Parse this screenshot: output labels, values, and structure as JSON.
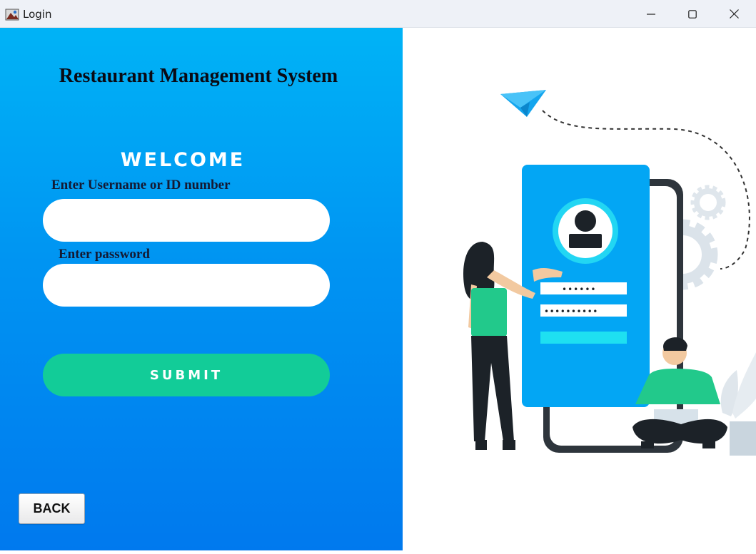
{
  "window": {
    "title": "Login",
    "controls": {
      "minimize": "minimize-icon",
      "maximize": "maximize-icon",
      "close": "close-icon"
    }
  },
  "login": {
    "app_title": "Restaurant Management System",
    "welcome": "WELCOME",
    "username_label": "Enter Username or ID number",
    "username_value": "",
    "password_label": "Enter password",
    "password_value": "",
    "submit_label": "SUBMIT",
    "back_label": "BACK"
  },
  "illustration": {
    "icons": [
      "paper-plane-icon",
      "user-avatar-icon",
      "gear-icon",
      "plant-icon"
    ],
    "password_mask_short": "••••••",
    "password_mask_long": "••••••••••"
  },
  "colors": {
    "panel_top": "#00b3f6",
    "panel_bottom": "#0079ee",
    "submit": "#12cc98",
    "phone": "#03a6f4",
    "accent_green": "#22c98b"
  }
}
